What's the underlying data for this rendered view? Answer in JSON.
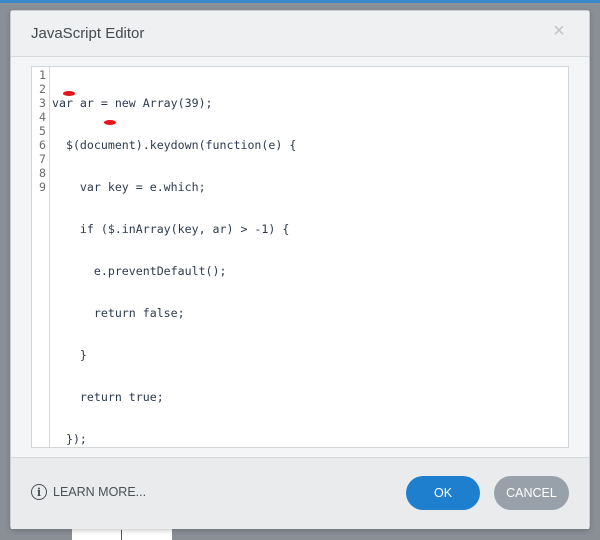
{
  "dialog": {
    "title": "JavaScript Editor",
    "close_glyph": "×"
  },
  "editor": {
    "line_numbers": [
      "1",
      "2",
      "3",
      "4",
      "5",
      "6",
      "7",
      "8",
      "9"
    ],
    "lines": [
      "var ar = new Array(39);",
      "  $(document).keydown(function(e) {",
      "    var key = e.which;",
      "    if ($.inArray(key, ar) > -1) {",
      "      e.preventDefault();",
      "      return false;",
      "    }",
      "    return true;",
      "  });"
    ]
  },
  "footer": {
    "learn_more_label": "LEARN MORE...",
    "info_glyph": "i",
    "ok_label": "OK",
    "cancel_label": "CANCEL"
  },
  "colors": {
    "ok_button": "#1f7fcf",
    "cancel_button": "#98a1a9",
    "annotation_marker": "#e8141b"
  }
}
